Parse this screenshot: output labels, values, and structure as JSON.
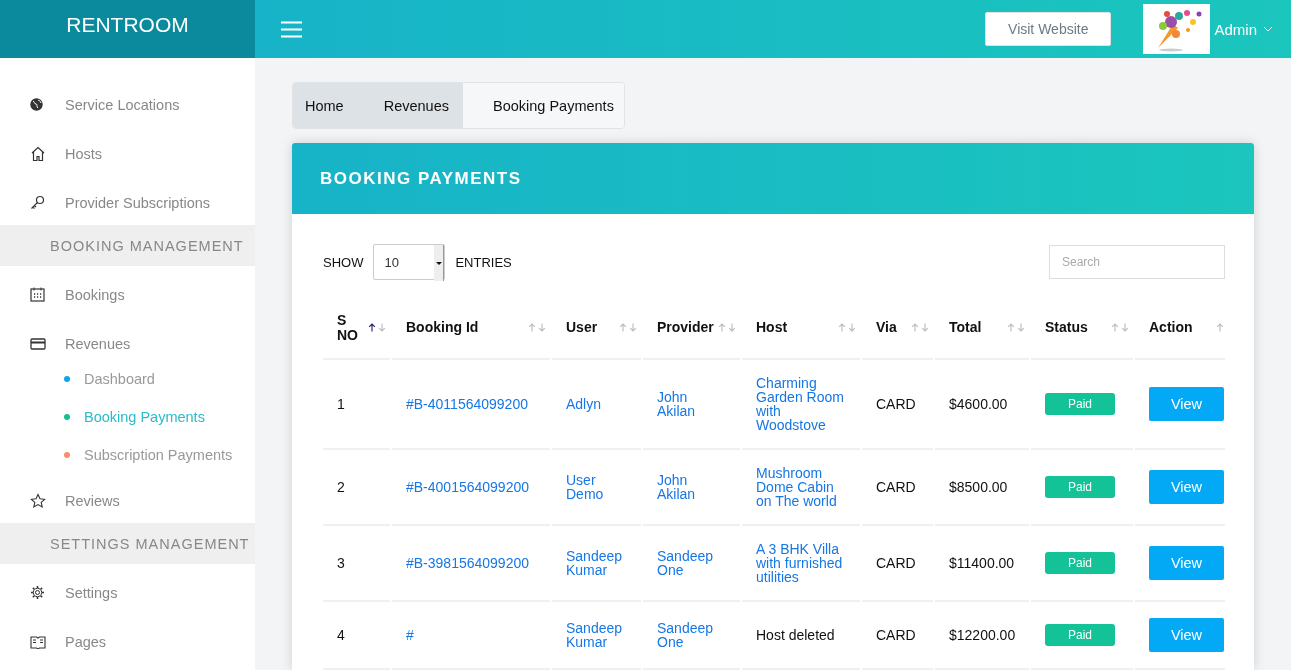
{
  "brand": "RENTROOM",
  "header": {
    "visit_button": "Visit Website",
    "user": "Admin"
  },
  "sidebar": {
    "items": [
      {
        "kind": "item",
        "label": "Service Locations",
        "selected": false
      },
      {
        "kind": "item",
        "label": "Hosts",
        "selected": false
      },
      {
        "kind": "item",
        "label": "Provider Subscriptions",
        "selected": false
      },
      {
        "kind": "section",
        "label": "BOOKING MANAGEMENT"
      },
      {
        "kind": "item",
        "label": "Bookings",
        "selected": false
      },
      {
        "kind": "item",
        "label": "Revenues",
        "selected": false,
        "children": [
          {
            "label": "Dashboard",
            "color": "#0ea5e9",
            "selected": false
          },
          {
            "label": "Booking Payments",
            "color": "#12c08f",
            "selected": true
          },
          {
            "label": "Subscription Payments",
            "color": "#f98c6b",
            "selected": false
          }
        ]
      },
      {
        "kind": "item",
        "label": "Reviews",
        "selected": false
      },
      {
        "kind": "section",
        "label": "SETTINGS MANAGEMENT"
      },
      {
        "kind": "item",
        "label": "Settings",
        "selected": false
      },
      {
        "kind": "item",
        "label": "Pages",
        "selected": false
      }
    ]
  },
  "breadcrumb": [
    "Home",
    "Revenues",
    "Booking Payments"
  ],
  "card": {
    "title": "BOOKING PAYMENTS",
    "show_label": "SHOW",
    "page_size": "10",
    "entries_label": "ENTRIES",
    "search": {
      "placeholder": "Search"
    },
    "table": {
      "columns": [
        {
          "label": "S NO",
          "sorted_asc": true
        },
        {
          "label": "Booking Id",
          "sorted_asc": false
        },
        {
          "label": "User",
          "sorted_asc": false
        },
        {
          "label": "Provider",
          "sorted_asc": false
        },
        {
          "label": "Host",
          "sorted_asc": false
        },
        {
          "label": "Via",
          "sorted_asc": false
        },
        {
          "label": "Total",
          "sorted_asc": false
        },
        {
          "label": "Status",
          "sorted_asc": false
        },
        {
          "label": "Action",
          "sorted_asc": false
        }
      ],
      "rows": [
        {
          "sno": "1",
          "booking_id": "#B-4011564099200",
          "user": "Adlyn",
          "provider": "John Akilan",
          "host": "Charming Garden Room with Woodstove",
          "host_link": true,
          "via": "CARD",
          "total": "$4600.00",
          "status": "Paid",
          "action": "View"
        },
        {
          "sno": "2",
          "booking_id": "#B-4001564099200",
          "user": "User Demo",
          "provider": "John Akilan",
          "host": "Mushroom Dome Cabin on The world",
          "host_link": true,
          "via": "CARD",
          "total": "$8500.00",
          "status": "Paid",
          "action": "View"
        },
        {
          "sno": "3",
          "booking_id": "#B-3981564099200",
          "user": "Sandeep Kumar",
          "provider": "Sandeep One",
          "host": "A 3 BHK Villa with furnished utilities",
          "host_link": true,
          "via": "CARD",
          "total": "$11400.00",
          "status": "Paid",
          "action": "View"
        },
        {
          "sno": "4",
          "booking_id": "#",
          "user": "Sandeep Kumar",
          "provider": "Sandeep One",
          "host": "Host deleted",
          "host_link": false,
          "via": "CARD",
          "total": "$12200.00",
          "status": "Paid",
          "action": "View"
        }
      ]
    }
  }
}
